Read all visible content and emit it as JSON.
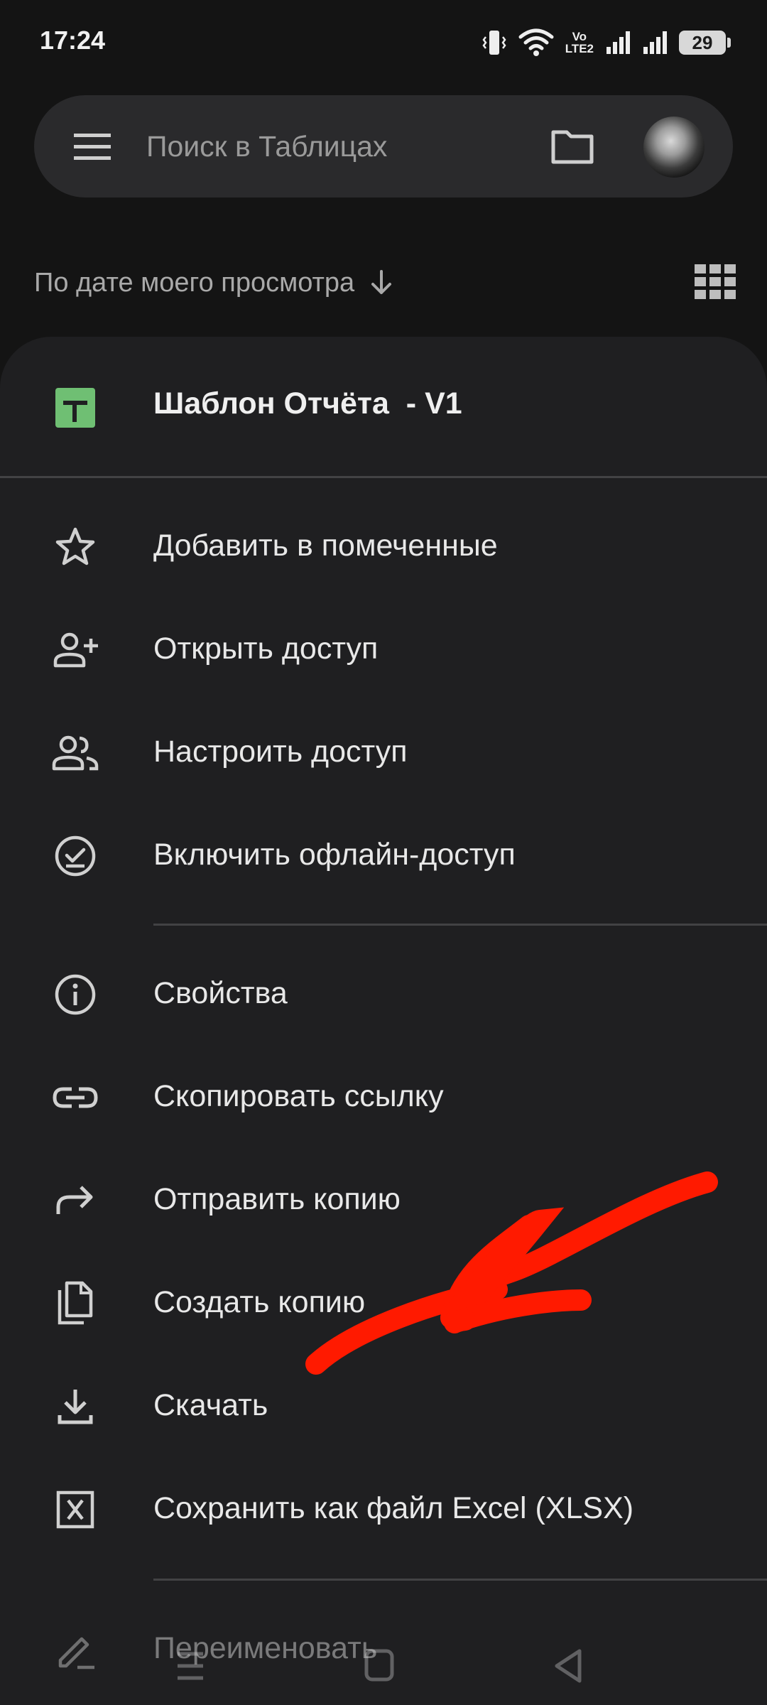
{
  "status_bar": {
    "time": "17:24",
    "volte_line1": "Vo",
    "volte_line2": "LTE2",
    "battery": "29"
  },
  "search": {
    "placeholder": "Поиск в Таблицах"
  },
  "sort": {
    "label": "По дате моего просмотра"
  },
  "sheet": {
    "file_title": "Шаблон Отчёта  - V1",
    "items": [
      {
        "label": "Добавить в помеченные",
        "icon": "star-outline-icon"
      },
      {
        "label": "Открыть доступ",
        "icon": "person-add-icon"
      },
      {
        "label": "Настроить доступ",
        "icon": "people-icon"
      },
      {
        "label": "Включить офлайн-доступ",
        "icon": "offline-check-icon"
      },
      {
        "label": "Свойства",
        "icon": "info-icon"
      },
      {
        "label": "Скопировать ссылку",
        "icon": "link-icon"
      },
      {
        "label": "Отправить копию",
        "icon": "forward-arrow-icon"
      },
      {
        "label": "Создать копию",
        "icon": "copy-icon"
      },
      {
        "label": "Скачать",
        "icon": "download-icon"
      },
      {
        "label": "Сохранить как файл Excel (XLSX)",
        "icon": "excel-file-icon"
      },
      {
        "label": "Переименовать",
        "icon": "pencil-icon"
      }
    ]
  },
  "colors": {
    "background": "#141414",
    "sheet": "#1f1f21",
    "search_bar": "#2a2a2c",
    "sheets_green": "#6fbf73",
    "annotation_red": "#ff1a00"
  }
}
